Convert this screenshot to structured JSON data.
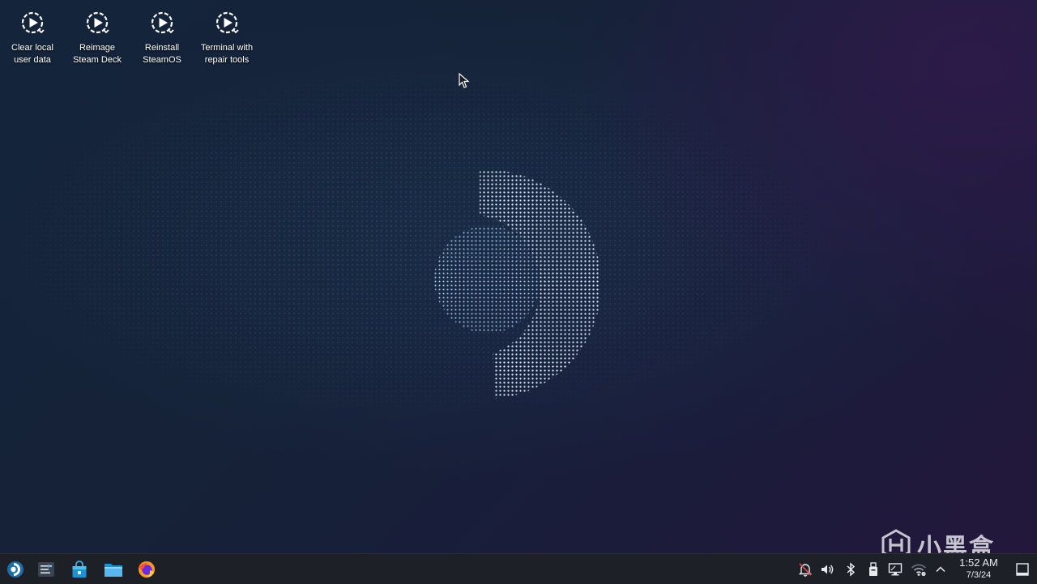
{
  "desktop_icons": [
    {
      "label": "Clear local\nuser data",
      "icon": "recovery-action-icon"
    },
    {
      "label": "Reimage\nSteam Deck",
      "icon": "recovery-action-icon"
    },
    {
      "label": "Reinstall\nSteamOS",
      "icon": "recovery-action-icon"
    },
    {
      "label": "Terminal with\nrepair tools",
      "icon": "recovery-action-icon"
    }
  ],
  "taskbar": {
    "launchers": [
      {
        "name": "application-launcher",
        "icon": "steam-deck-launcher-icon"
      },
      {
        "name": "system-settings",
        "icon": "settings-sliders-icon"
      },
      {
        "name": "discover-store",
        "icon": "shopping-bag-icon"
      },
      {
        "name": "dolphin-file-manager",
        "icon": "folder-icon"
      },
      {
        "name": "firefox-browser",
        "icon": "firefox-icon"
      }
    ],
    "tray": [
      {
        "name": "notifications",
        "icon": "bell-muted-icon"
      },
      {
        "name": "volume",
        "icon": "speaker-icon"
      },
      {
        "name": "bluetooth",
        "icon": "bluetooth-icon"
      },
      {
        "name": "storage-device",
        "icon": "usb-drive-icon"
      },
      {
        "name": "display-configuration",
        "icon": "monitor-icon"
      },
      {
        "name": "wifi",
        "icon": "wifi-icon"
      },
      {
        "name": "show-hidden-icons",
        "icon": "chevron-up-icon"
      }
    ],
    "clock": {
      "time": "1:52 AM",
      "date": "7/3/24"
    },
    "show_desktop_icon": "show-desktop-icon"
  },
  "watermark": {
    "text": "小黑盒"
  },
  "colors": {
    "taskbar_bg": "#1d2127",
    "text": "#ffffff",
    "accent_blue": "#3daee9",
    "steam_dots": "#cfe3f5"
  }
}
